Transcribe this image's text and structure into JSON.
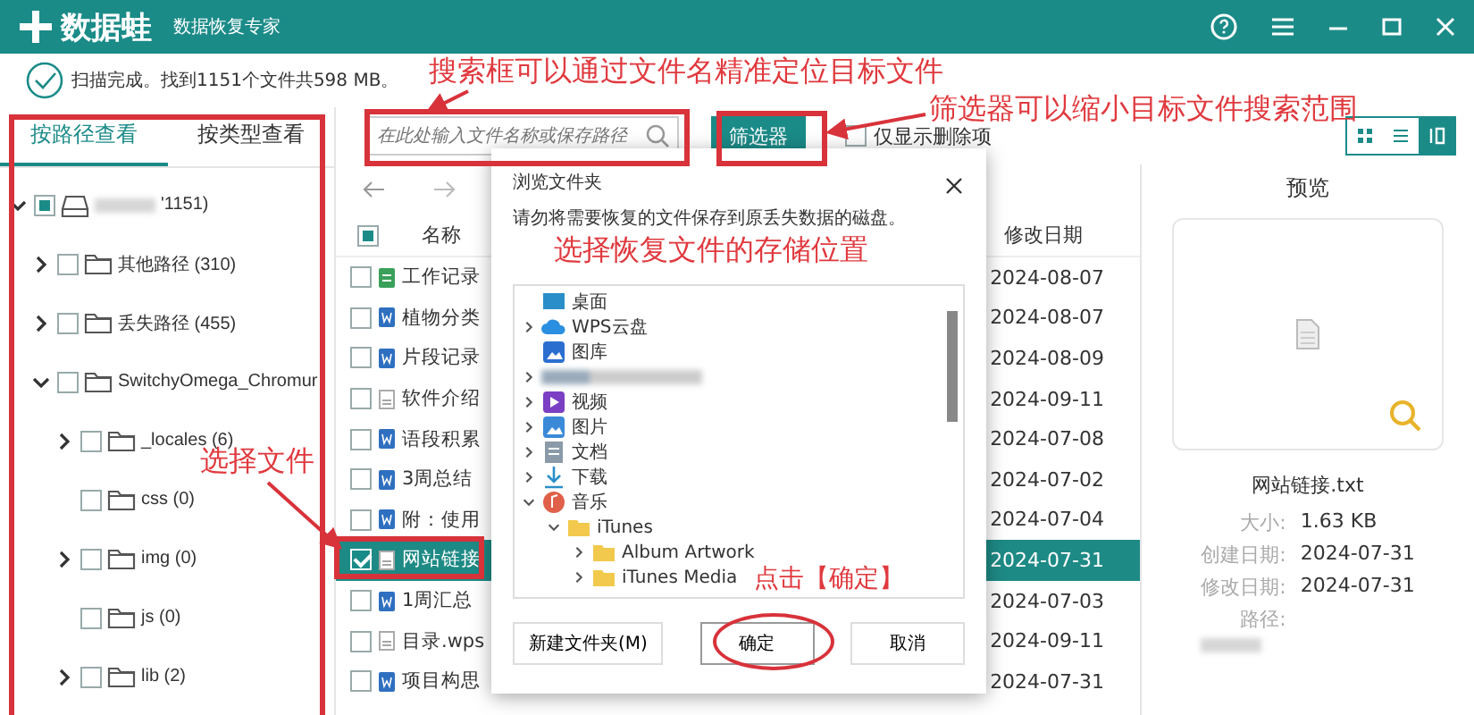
{
  "window": {
    "app_name": "数据蛙",
    "subtitle": "数据恢复专家"
  },
  "scan_status": "扫描完成。找到1151个文件共598 MB。",
  "sidebar": {
    "tabs": [
      {
        "label": "按路径查看",
        "selected": true
      },
      {
        "label": "按类型查看",
        "selected": false
      }
    ],
    "tree": [
      {
        "label": "'1151)",
        "kind": "drive",
        "partial": true,
        "expanded": true,
        "children": [
          {
            "label": "其他路径 (310)",
            "kind": "folder",
            "checked": false,
            "partial": false,
            "expanded": false
          },
          {
            "label": "丢失路径 (455)",
            "kind": "folder",
            "checked": false,
            "partial": false,
            "expanded": false
          },
          {
            "label": "SwitchyOmega_Chromur",
            "kind": "folder",
            "checked": false,
            "partial": false,
            "expanded": true,
            "children": [
              {
                "label": "_locales (6)",
                "kind": "folder",
                "checked": false,
                "partial": false,
                "expanded": false
              },
              {
                "label": "css (0)",
                "kind": "folder",
                "checked": false,
                "partial": false
              },
              {
                "label": "img (0)",
                "kind": "folder",
                "checked": false,
                "partial": false,
                "expanded": false
              },
              {
                "label": "js (0)",
                "kind": "folder",
                "checked": false,
                "partial": false
              },
              {
                "label": "lib (2)",
                "kind": "folder",
                "checked": false,
                "partial": false,
                "expanded": false
              }
            ]
          }
        ]
      }
    ]
  },
  "toolbar": {
    "search_placeholder": "在此处输入文件名称或保存路径",
    "filter_button": "筛选器",
    "deleted_only": {
      "label": "仅显示删除项",
      "checked": false
    },
    "views": [
      {
        "kind": "grid",
        "selected": false
      },
      {
        "kind": "list",
        "selected": false
      },
      {
        "kind": "columns",
        "selected": true
      }
    ]
  },
  "file_list": {
    "header_partial": true,
    "columns": [
      "名称",
      "修改日期"
    ],
    "rows": [
      {
        "name": "工作记录",
        "date": "2024-08-07",
        "kind": "sheet",
        "checked": false,
        "selected": false
      },
      {
        "name": "植物分类",
        "date": "2024-08-07",
        "kind": "doc",
        "checked": false,
        "selected": false
      },
      {
        "name": "片段记录",
        "date": "2024-08-09",
        "kind": "doc",
        "checked": false,
        "selected": false
      },
      {
        "name": "软件介绍",
        "date": "2024-09-11",
        "kind": "text",
        "checked": false,
        "selected": false
      },
      {
        "name": "语段积累",
        "date": "2024-07-08",
        "kind": "doc",
        "checked": false,
        "selected": false
      },
      {
        "name": "3周总结",
        "date": "2024-07-02",
        "kind": "doc",
        "checked": false,
        "selected": false
      },
      {
        "name": "附：使用",
        "date": "2024-07-04",
        "kind": "doc",
        "checked": false,
        "selected": false
      },
      {
        "name": "网站链接",
        "date": "2024-07-31",
        "kind": "text",
        "checked": true,
        "selected": true
      },
      {
        "name": "1周汇总",
        "date": "2024-07-03",
        "kind": "doc",
        "checked": false,
        "selected": false
      },
      {
        "name": "目录.wps",
        "date": "2024-09-11",
        "kind": "text",
        "checked": false,
        "selected": false
      },
      {
        "name": "项目构思",
        "date": "2024-07-31",
        "kind": "doc",
        "checked": false,
        "selected": false
      }
    ]
  },
  "preview": {
    "title": "预览",
    "file_name": "网站链接.txt",
    "details": [
      {
        "label": "大小:",
        "value": "1.63 KB"
      },
      {
        "label": "创建日期:",
        "value": "2024-07-31"
      },
      {
        "label": "修改日期:",
        "value": "2024-07-31"
      },
      {
        "label": "路径:",
        "value_blurred": true
      }
    ]
  },
  "dialog": {
    "title": "浏览文件夹",
    "message": "请勿将需要恢复的文件保存到原丢失数据的磁盘。",
    "folders": [
      {
        "label": "桌面",
        "kind": "desktop"
      },
      {
        "label": "WPS云盘",
        "kind": "cloud",
        "expanded": false
      },
      {
        "label": "图库",
        "kind": "gallery"
      },
      {
        "kind": "blurred",
        "expanded": false
      },
      {
        "label": "视频",
        "kind": "video",
        "expanded": false
      },
      {
        "label": "图片",
        "kind": "pictures",
        "expanded": false
      },
      {
        "label": "文档",
        "kind": "documents",
        "expanded": false
      },
      {
        "label": "下载",
        "kind": "downloads",
        "expanded": false
      },
      {
        "label": "音乐",
        "kind": "music",
        "expanded": true,
        "children": [
          {
            "label": "iTunes",
            "kind": "folder",
            "expanded": true,
            "children": [
              {
                "label": "Album Artwork",
                "kind": "folder",
                "expanded": false
              },
              {
                "label": "iTunes Media",
                "kind": "folder",
                "expanded": false
              }
            ]
          }
        ]
      }
    ],
    "buttons": [
      {
        "label": "新建文件夹(M)",
        "kind": "secondary"
      },
      {
        "label": "确定",
        "kind": "primary"
      },
      {
        "label": "取消",
        "kind": "secondary"
      }
    ]
  },
  "annotations": [
    {
      "text": "搜索框可以通过文件名精准定位目标文件",
      "kind": "search"
    },
    {
      "text": "筛选器可以缩小目标文件搜索范围",
      "kind": "filter"
    },
    {
      "text": "选择恢复文件的存储位置",
      "kind": "location"
    },
    {
      "text": "选择文件",
      "kind": "select"
    },
    {
      "text": "点击【确定】",
      "kind": "confirm"
    }
  ]
}
